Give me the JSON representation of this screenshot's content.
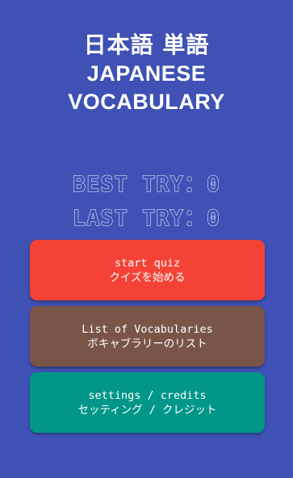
{
  "title": {
    "japanese": "日本語 単語",
    "english_line1": "JAPANESE",
    "english_line2": "VOCABULARY"
  },
  "scores": {
    "best_label": "BEST TRY",
    "best_value": "0",
    "last_label": "LAST TRY",
    "last_value": "0",
    "separator": "："
  },
  "buttons": {
    "start": {
      "label_en": "start quiz",
      "label_jp": "クイズを始める",
      "color": "#f44336"
    },
    "list": {
      "label_en": "List of Vocabularies",
      "label_jp": "ボキャブラリーのリスト",
      "color": "#795548"
    },
    "settings": {
      "label_en": "settings / credits",
      "label_jp": "セッティング / クレジット",
      "color": "#009688"
    }
  },
  "colors": {
    "background": "#3f51b5",
    "text": "#ffffff"
  }
}
